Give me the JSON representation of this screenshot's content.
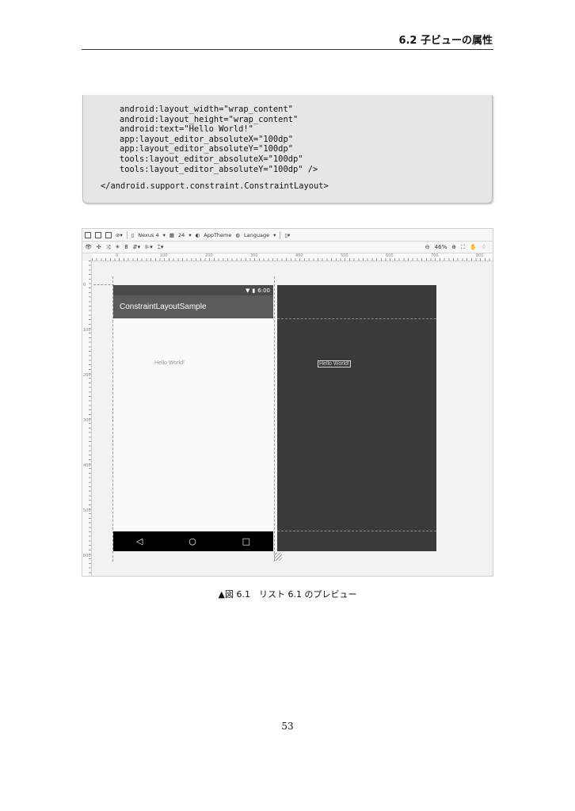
{
  "header": {
    "section_title": "6.2 子ビューの属性"
  },
  "code_listing": {
    "lines": [
      "android:layout_width=\"wrap_content\"",
      "android:layout_height=\"wrap_content\"",
      "android:text=\"Hello World!\"",
      "app:layout_editor_absoluteX=\"100dp\"",
      "app:layout_editor_absoluteY=\"100dp\"",
      "tools:layout_editor_absoluteX=\"100dp\"",
      "tools:layout_editor_absoluteY=\"100dp\" />",
      "</android.support.constraint.ConstraintLayout>"
    ]
  },
  "screenshot": {
    "toolbar": {
      "device": "Nexus 4",
      "api_level": "24",
      "theme": "AppTheme",
      "language": "Language",
      "zoom": "46%",
      "margin_value": "8"
    },
    "ruler_top_labels": [
      "0",
      "100",
      "200",
      "300",
      "400",
      "500",
      "600",
      "700",
      "800"
    ],
    "ruler_left_labels": [
      "0",
      "100",
      "200",
      "300",
      "400",
      "500",
      "600"
    ],
    "design_view": {
      "status_time": "6:00",
      "app_title": "ConstraintLayoutSample",
      "hello_text": "Hello World!",
      "nav_back": "◁",
      "nav_home": "○",
      "nav_recent": "□"
    },
    "blueprint_view": {
      "hello_text": "Hello World!"
    }
  },
  "figure": {
    "caption": "▲図 6.1　リスト 6.1 のプレビュー"
  },
  "footer": {
    "page_number": "53"
  },
  "colors": {
    "app_bar": "#5b5b5b",
    "blueprint_bg": "#3a3a3a",
    "code_box_bg": "#e6e6e6"
  }
}
